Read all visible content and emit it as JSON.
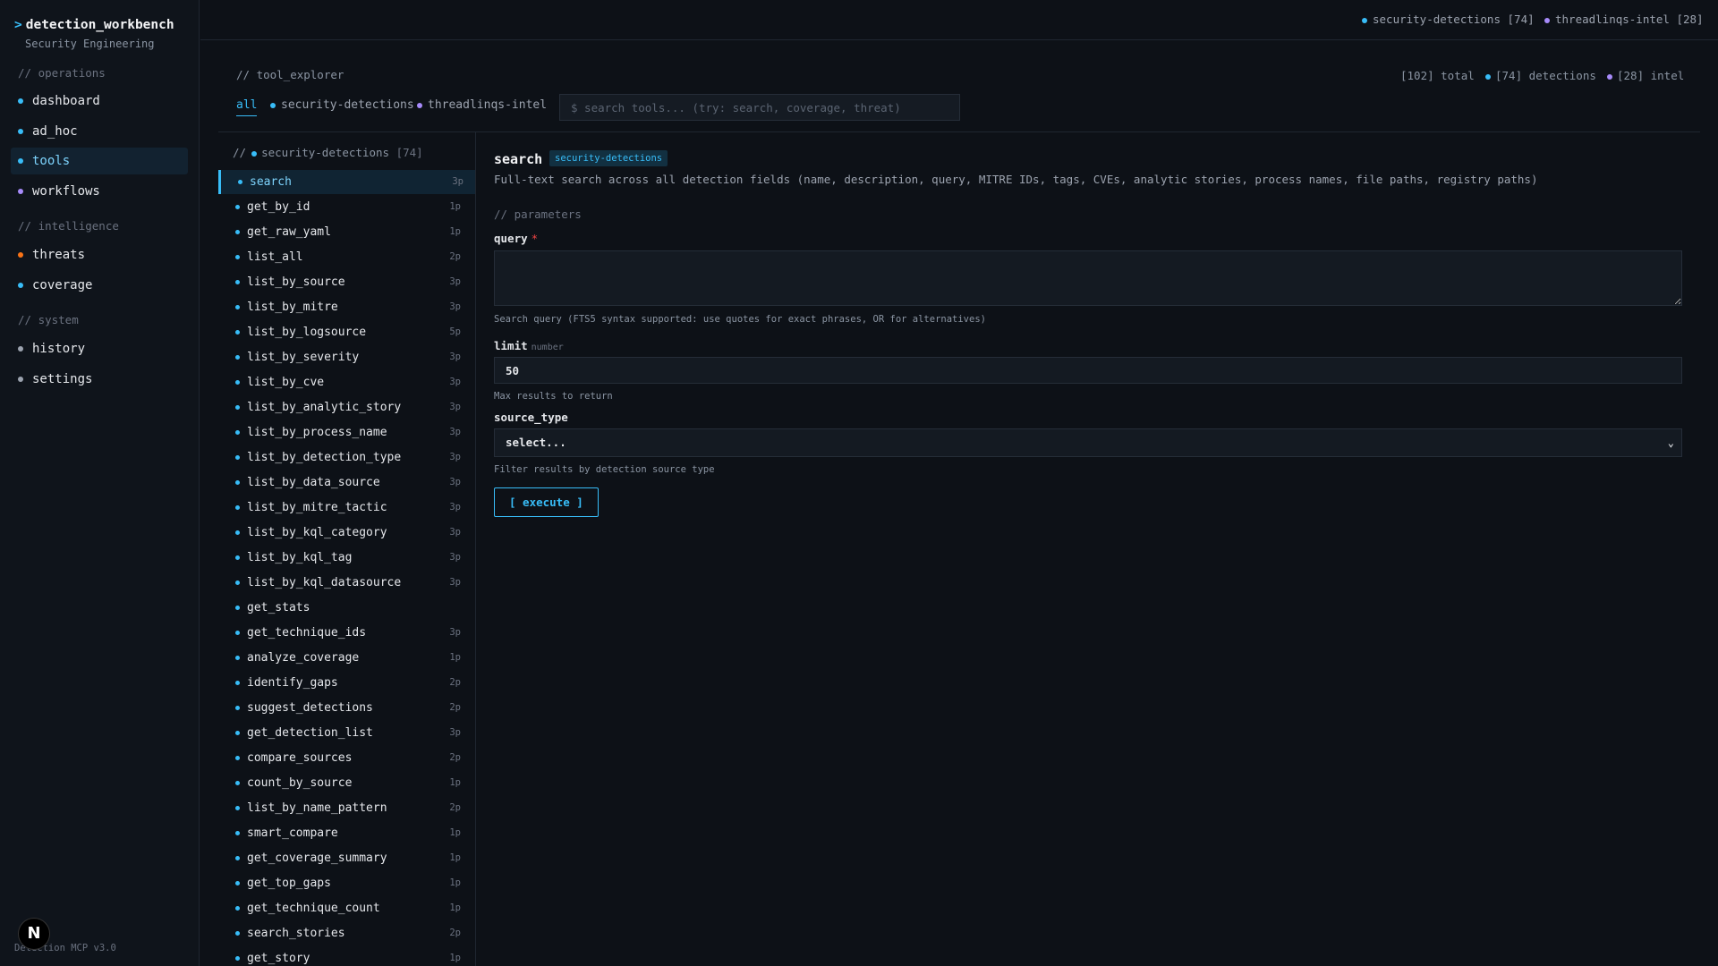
{
  "brand": {
    "prompt": ">",
    "title": "detection_workbench",
    "subtitle": "Security Engineering"
  },
  "sidebar": {
    "sections": [
      {
        "label": "// operations",
        "items": [
          {
            "label": "dashboard",
            "dot": "#38bdf8"
          },
          {
            "label": "ad_hoc",
            "dot": "#38bdf8"
          },
          {
            "label": "tools",
            "dot": "#38bdf8",
            "active": true
          },
          {
            "label": "workflows",
            "dot": "#a78bfa"
          }
        ]
      },
      {
        "label": "// intelligence",
        "items": [
          {
            "label": "threats",
            "dot": "#f97316"
          },
          {
            "label": "coverage",
            "dot": "#38bdf8"
          }
        ]
      },
      {
        "label": "// system",
        "items": [
          {
            "label": "history",
            "dot": "#9ca3af"
          },
          {
            "label": "settings",
            "dot": "#9ca3af"
          }
        ]
      }
    ],
    "footer": "Detection MCP v3.0",
    "badge": "N"
  },
  "topbar": {
    "stats": [
      {
        "label": "security-detections [74]",
        "dot": "#38bdf8"
      },
      {
        "label": "threadlinqs-intel [28]",
        "dot": "#a78bfa"
      }
    ]
  },
  "explorer": {
    "title": "// tool_explorer",
    "counts": {
      "total": "[102] total",
      "detections": "[74] detections",
      "intel": "[28] intel"
    },
    "filter_tabs": [
      {
        "label": "all",
        "active": true
      },
      {
        "label": "security-detections",
        "dot": "#38bdf8"
      },
      {
        "label": "threadlinqs-intel",
        "dot": "#a78bfa"
      }
    ],
    "search_placeholder": "$ search tools... (try: search, coverage, threat)"
  },
  "tool_group": {
    "prefix": "//",
    "name": "security-detections",
    "count": "[74]"
  },
  "tools": [
    {
      "name": "search",
      "params": "3p",
      "active": true
    },
    {
      "name": "get_by_id",
      "params": "1p"
    },
    {
      "name": "get_raw_yaml",
      "params": "1p"
    },
    {
      "name": "list_all",
      "params": "2p"
    },
    {
      "name": "list_by_source",
      "params": "3p"
    },
    {
      "name": "list_by_mitre",
      "params": "3p"
    },
    {
      "name": "list_by_logsource",
      "params": "5p"
    },
    {
      "name": "list_by_severity",
      "params": "3p"
    },
    {
      "name": "list_by_cve",
      "params": "3p"
    },
    {
      "name": "list_by_analytic_story",
      "params": "3p"
    },
    {
      "name": "list_by_process_name",
      "params": "3p"
    },
    {
      "name": "list_by_detection_type",
      "params": "3p"
    },
    {
      "name": "list_by_data_source",
      "params": "3p"
    },
    {
      "name": "list_by_mitre_tactic",
      "params": "3p"
    },
    {
      "name": "list_by_kql_category",
      "params": "3p"
    },
    {
      "name": "list_by_kql_tag",
      "params": "3p"
    },
    {
      "name": "list_by_kql_datasource",
      "params": "3p"
    },
    {
      "name": "get_stats",
      "params": ""
    },
    {
      "name": "get_technique_ids",
      "params": "3p"
    },
    {
      "name": "analyze_coverage",
      "params": "1p"
    },
    {
      "name": "identify_gaps",
      "params": "2p"
    },
    {
      "name": "suggest_detections",
      "params": "2p"
    },
    {
      "name": "get_detection_list",
      "params": "3p"
    },
    {
      "name": "compare_sources",
      "params": "2p"
    },
    {
      "name": "count_by_source",
      "params": "1p"
    },
    {
      "name": "list_by_name_pattern",
      "params": "2p"
    },
    {
      "name": "smart_compare",
      "params": "1p"
    },
    {
      "name": "get_coverage_summary",
      "params": "1p"
    },
    {
      "name": "get_top_gaps",
      "params": "1p"
    },
    {
      "name": "get_technique_count",
      "params": "1p"
    },
    {
      "name": "search_stories",
      "params": "2p"
    },
    {
      "name": "get_story",
      "params": "1p"
    }
  ],
  "detail": {
    "title": "search",
    "badge": "security-detections",
    "description": "Full-text search across all detection fields (name, description, query, MITRE IDs, tags, CVEs, analytic stories, process names, file paths, registry paths)",
    "section_label": "// parameters",
    "params": {
      "query": {
        "label": "query",
        "required": "*",
        "value": "",
        "help": "Search query (FTS5 syntax supported: use quotes for exact phrases, OR for alternatives)"
      },
      "limit": {
        "label": "limit",
        "type": "number",
        "value": "50",
        "help": "Max results to return"
      },
      "source_type": {
        "label": "source_type",
        "selected": "select...",
        "help": "Filter results by detection source type"
      }
    },
    "execute_label": "[ execute ]"
  },
  "colors": {
    "accent": "#38bdf8",
    "purple": "#a78bfa",
    "orange": "#f97316",
    "background": "#0d1117"
  }
}
